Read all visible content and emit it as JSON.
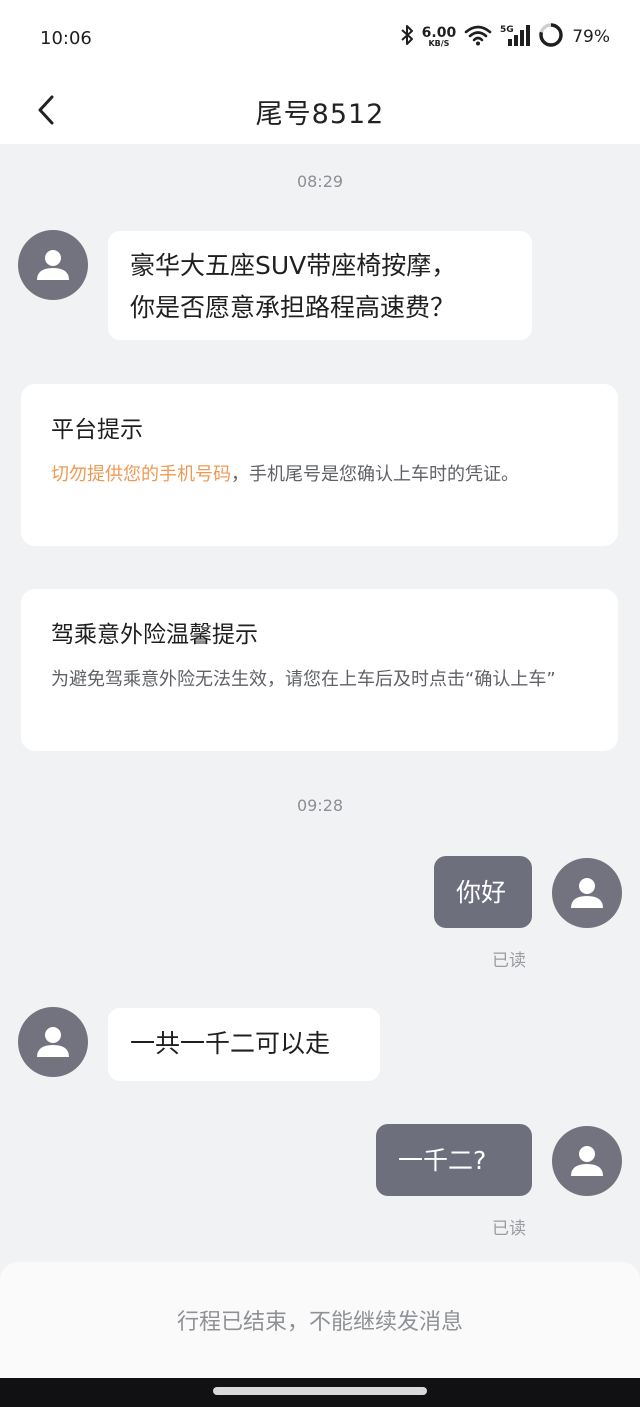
{
  "status_bar": {
    "time": "10:06",
    "net_speed_value": "6.00",
    "net_speed_unit": "KB/S",
    "network_type": "5G",
    "battery_percent": "79%",
    "battery_level": 0.79
  },
  "header": {
    "title": "尾号8512"
  },
  "chat": {
    "timestamp_1": "08:29",
    "msg_1_line1": "豪华大五座SUV带座椅按摩，",
    "msg_1_line2": "你是否愿意承担路程高速费？",
    "notice_1": {
      "title": "平台提示",
      "highlight": "切勿提供您的手机号码",
      "body": "，手机尾号是您确认上车时的凭证。"
    },
    "notice_2": {
      "title": "驾乘意外险温馨提示",
      "body": "为避免驾乘意外险无法生效，请您在上车后及时点击“确认上车”"
    },
    "timestamp_2": "09:28",
    "msg_2": "你好",
    "msg_2_status": "已读",
    "msg_3": "一共一千二可以走",
    "msg_4": "一千二?",
    "msg_4_status": "已读"
  },
  "footer": {
    "text": "行程已结束，不能继续发消息"
  },
  "colors": {
    "background": "#f1f2f4",
    "outgoing_bubble": "#6e6f7c",
    "avatar": "#72737f",
    "highlight": "#ee9a54"
  }
}
